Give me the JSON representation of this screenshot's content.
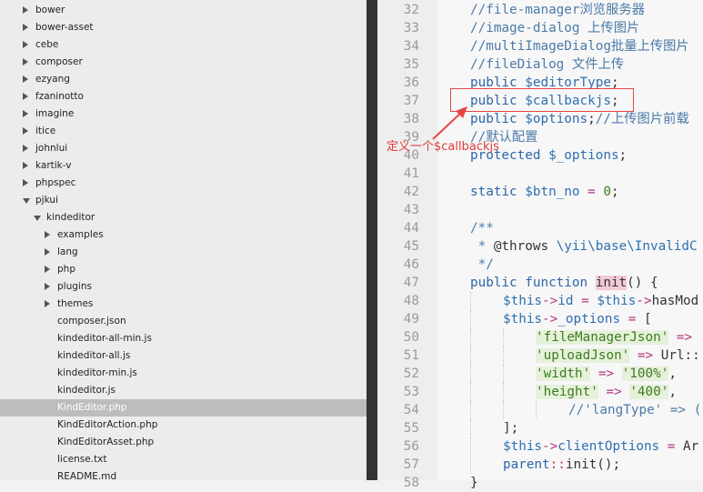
{
  "sidebar": {
    "items": [
      {
        "label": "bower",
        "depth": 0,
        "state": "closed"
      },
      {
        "label": "bower-asset",
        "depth": 0,
        "state": "closed"
      },
      {
        "label": "cebe",
        "depth": 0,
        "state": "closed"
      },
      {
        "label": "composer",
        "depth": 0,
        "state": "closed"
      },
      {
        "label": "ezyang",
        "depth": 0,
        "state": "closed"
      },
      {
        "label": "fzaninotto",
        "depth": 0,
        "state": "closed"
      },
      {
        "label": "imagine",
        "depth": 0,
        "state": "closed"
      },
      {
        "label": "itice",
        "depth": 0,
        "state": "closed"
      },
      {
        "label": "johnlui",
        "depth": 0,
        "state": "closed"
      },
      {
        "label": "kartik-v",
        "depth": 0,
        "state": "closed"
      },
      {
        "label": "phpspec",
        "depth": 0,
        "state": "closed"
      },
      {
        "label": "pjkui",
        "depth": 0,
        "state": "open"
      },
      {
        "label": "kindeditor",
        "depth": 1,
        "state": "open"
      },
      {
        "label": "examples",
        "depth": 2,
        "state": "closed"
      },
      {
        "label": "lang",
        "depth": 2,
        "state": "closed"
      },
      {
        "label": "php",
        "depth": 2,
        "state": "closed"
      },
      {
        "label": "plugins",
        "depth": 2,
        "state": "closed"
      },
      {
        "label": "themes",
        "depth": 2,
        "state": "closed"
      },
      {
        "label": "composer.json",
        "depth": 2,
        "state": "file"
      },
      {
        "label": "kindeditor-all-min.js",
        "depth": 2,
        "state": "file"
      },
      {
        "label": "kindeditor-all.js",
        "depth": 2,
        "state": "file"
      },
      {
        "label": "kindeditor-min.js",
        "depth": 2,
        "state": "file"
      },
      {
        "label": "kindeditor.js",
        "depth": 2,
        "state": "file"
      },
      {
        "label": "KindEditor.php",
        "depth": 2,
        "state": "file",
        "selected": true
      },
      {
        "label": "KindEditorAction.php",
        "depth": 2,
        "state": "file"
      },
      {
        "label": "KindEditorAsset.php",
        "depth": 2,
        "state": "file"
      },
      {
        "label": "license.txt",
        "depth": 2,
        "state": "file"
      },
      {
        "label": "README.md",
        "depth": 2,
        "state": "file"
      }
    ]
  },
  "editor": {
    "lines": [
      {
        "n": "32",
        "indent": 0,
        "tokens": [
          [
            "comment",
            "//file-manager浏览服务器"
          ]
        ]
      },
      {
        "n": "33",
        "indent": 0,
        "tokens": [
          [
            "comment",
            "//image-dialog 上传图片"
          ]
        ]
      },
      {
        "n": "34",
        "indent": 0,
        "tokens": [
          [
            "comment",
            "//multiImageDialog批量上传图片"
          ]
        ]
      },
      {
        "n": "35",
        "indent": 0,
        "tokens": [
          [
            "comment",
            "//fileDialog 文件上传"
          ]
        ]
      },
      {
        "n": "36",
        "indent": 0,
        "tokens": [
          [
            "keyword",
            "public "
          ],
          [
            "var",
            "$editorType"
          ],
          [
            "plain",
            ";"
          ]
        ]
      },
      {
        "n": "37",
        "indent": 0,
        "tokens": [
          [
            "keyword",
            "public "
          ],
          [
            "var",
            "$callbackjs"
          ],
          [
            "plain",
            ";"
          ]
        ]
      },
      {
        "n": "38",
        "indent": 0,
        "tokens": [
          [
            "keyword",
            "public "
          ],
          [
            "var",
            "$options"
          ],
          [
            "plain",
            ";"
          ],
          [
            "comment",
            "//上传图片前载"
          ]
        ]
      },
      {
        "n": "39",
        "indent": 0,
        "tokens": [
          [
            "comment",
            "//默认配置"
          ]
        ]
      },
      {
        "n": "40",
        "indent": 0,
        "tokens": [
          [
            "keyword",
            "protected "
          ],
          [
            "var",
            "$_options"
          ],
          [
            "plain",
            ";"
          ]
        ]
      },
      {
        "n": "41",
        "indent": 0,
        "tokens": []
      },
      {
        "n": "42",
        "indent": 0,
        "tokens": [
          [
            "keyword",
            "static "
          ],
          [
            "var",
            "$btn_no"
          ],
          [
            "op",
            " = "
          ],
          [
            "number",
            "0"
          ],
          [
            "plain",
            ";"
          ]
        ]
      },
      {
        "n": "43",
        "indent": 0,
        "tokens": []
      },
      {
        "n": "44",
        "indent": 0,
        "tokens": [
          [
            "comment",
            "/**"
          ]
        ]
      },
      {
        "n": "45",
        "indent": 0,
        "tokens": [
          [
            "comment",
            " * "
          ],
          [
            "plain",
            "@throws "
          ],
          [
            "var",
            "\\yii\\base\\InvalidC"
          ]
        ]
      },
      {
        "n": "46",
        "indent": 0,
        "tokens": [
          [
            "comment",
            " */"
          ]
        ]
      },
      {
        "n": "47",
        "indent": 0,
        "tokens": [
          [
            "keyword",
            "public function "
          ],
          [
            "func",
            "init"
          ],
          [
            "plain",
            "() {"
          ]
        ]
      },
      {
        "n": "48",
        "indent": 1,
        "tokens": [
          [
            "var",
            "$this"
          ],
          [
            "op",
            "->"
          ],
          [
            "var",
            "id"
          ],
          [
            "op",
            " = "
          ],
          [
            "var",
            "$this"
          ],
          [
            "op",
            "->"
          ],
          [
            "plain",
            "hasMod"
          ]
        ]
      },
      {
        "n": "49",
        "indent": 1,
        "tokens": [
          [
            "var",
            "$this"
          ],
          [
            "op",
            "->"
          ],
          [
            "var",
            "_options"
          ],
          [
            "op",
            " = "
          ],
          [
            "plain",
            "["
          ]
        ]
      },
      {
        "n": "50",
        "indent": 2,
        "tokens": [
          [
            "string",
            "'fileManagerJson'"
          ],
          [
            "op",
            " =>"
          ]
        ]
      },
      {
        "n": "51",
        "indent": 2,
        "tokens": [
          [
            "string",
            "'uploadJson'"
          ],
          [
            "op",
            " => "
          ],
          [
            "plain",
            "Url::"
          ]
        ]
      },
      {
        "n": "52",
        "indent": 2,
        "tokens": [
          [
            "string",
            "'width'"
          ],
          [
            "op",
            " => "
          ],
          [
            "string",
            "'100%'"
          ],
          [
            "plain",
            ","
          ]
        ]
      },
      {
        "n": "53",
        "indent": 2,
        "tokens": [
          [
            "string",
            "'height'"
          ],
          [
            "op",
            " => "
          ],
          [
            "string",
            "'400'"
          ],
          [
            "plain",
            ","
          ]
        ]
      },
      {
        "n": "54",
        "indent": 3,
        "tokens": [
          [
            "comment",
            "//'langType' => ("
          ]
        ]
      },
      {
        "n": "55",
        "indent": 1,
        "tokens": [
          [
            "plain",
            "];"
          ]
        ]
      },
      {
        "n": "56",
        "indent": 1,
        "tokens": [
          [
            "var",
            "$this"
          ],
          [
            "op",
            "->"
          ],
          [
            "var",
            "clientOptions"
          ],
          [
            "op",
            " = "
          ],
          [
            "plain",
            "Ar"
          ]
        ]
      },
      {
        "n": "57",
        "indent": 1,
        "tokens": [
          [
            "keyword",
            "parent"
          ],
          [
            "op",
            "::"
          ],
          [
            "plain",
            "init();"
          ]
        ]
      },
      {
        "n": "58",
        "indent": 0,
        "tokens": [
          [
            "plain",
            "}"
          ]
        ]
      }
    ]
  },
  "annotation": {
    "label": "定义一个$callbackjs",
    "color": "#e03a3a"
  }
}
